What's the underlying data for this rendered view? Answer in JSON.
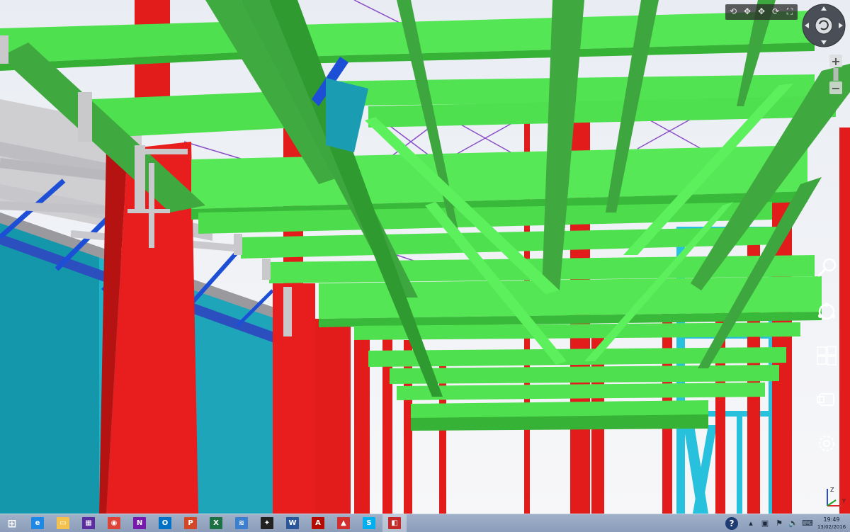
{
  "view_toolbar": {
    "buttons": [
      {
        "icon": "rotate-view-icon"
      },
      {
        "icon": "pan-icon"
      },
      {
        "icon": "move-icon"
      },
      {
        "icon": "orbit-icon"
      },
      {
        "icon": "fit-view-icon"
      }
    ],
    "glyphs": [
      "⟲",
      "✥",
      "✥",
      "⟳",
      "⛶"
    ]
  },
  "zoom": {
    "in_label": "+",
    "out_label": "−"
  },
  "side_tools": [
    "search-icon",
    "share-icon",
    "windows-start-icon",
    "devices-icon",
    "settings-icon"
  ],
  "axis": {
    "z_label": "Z",
    "y_label": "Y"
  },
  "taskbar": {
    "apps": [
      {
        "name": "start",
        "glyph": "⊞",
        "color": "#ffffff"
      },
      {
        "name": "internet-explorer",
        "glyph": "e",
        "color": "#1e88e5"
      },
      {
        "name": "file-explorer",
        "glyph": "▭",
        "color": "#f2c14e"
      },
      {
        "name": "photo-app",
        "glyph": "▦",
        "color": "#5b2ca0"
      },
      {
        "name": "chrome",
        "glyph": "◉",
        "color": "#db4437"
      },
      {
        "name": "onenote",
        "glyph": "N",
        "color": "#7719aa"
      },
      {
        "name": "outlook",
        "glyph": "O",
        "color": "#0072c6"
      },
      {
        "name": "powerpoint",
        "glyph": "P",
        "color": "#d24726"
      },
      {
        "name": "excel",
        "glyph": "X",
        "color": "#1e7145"
      },
      {
        "name": "winamp-wave",
        "glyph": "≋",
        "color": "#3d7fcf"
      },
      {
        "name": "inkscape",
        "glyph": "✦",
        "color": "#222222"
      },
      {
        "name": "word",
        "glyph": "W",
        "color": "#2b579a"
      },
      {
        "name": "acrobat",
        "glyph": "A",
        "color": "#b30b00"
      },
      {
        "name": "acrobat-reader",
        "glyph": "▲",
        "color": "#d32f2f"
      },
      {
        "name": "skype",
        "glyph": "S",
        "color": "#00aff0"
      },
      {
        "name": "tekla-viewer",
        "glyph": "◧",
        "color": "#c62828"
      }
    ],
    "active_index": 15,
    "tray": {
      "help": "?",
      "icons": [
        "tray-arrow-icon",
        "tray-network-icon",
        "tray-flag-icon",
        "tray-volume-icon",
        "tray-keyboard-icon"
      ],
      "glyphs": [
        "▴",
        "▣",
        "⚑",
        "🔈",
        "⌨"
      ],
      "time": "19:49",
      "date": "13/02/2016"
    }
  }
}
